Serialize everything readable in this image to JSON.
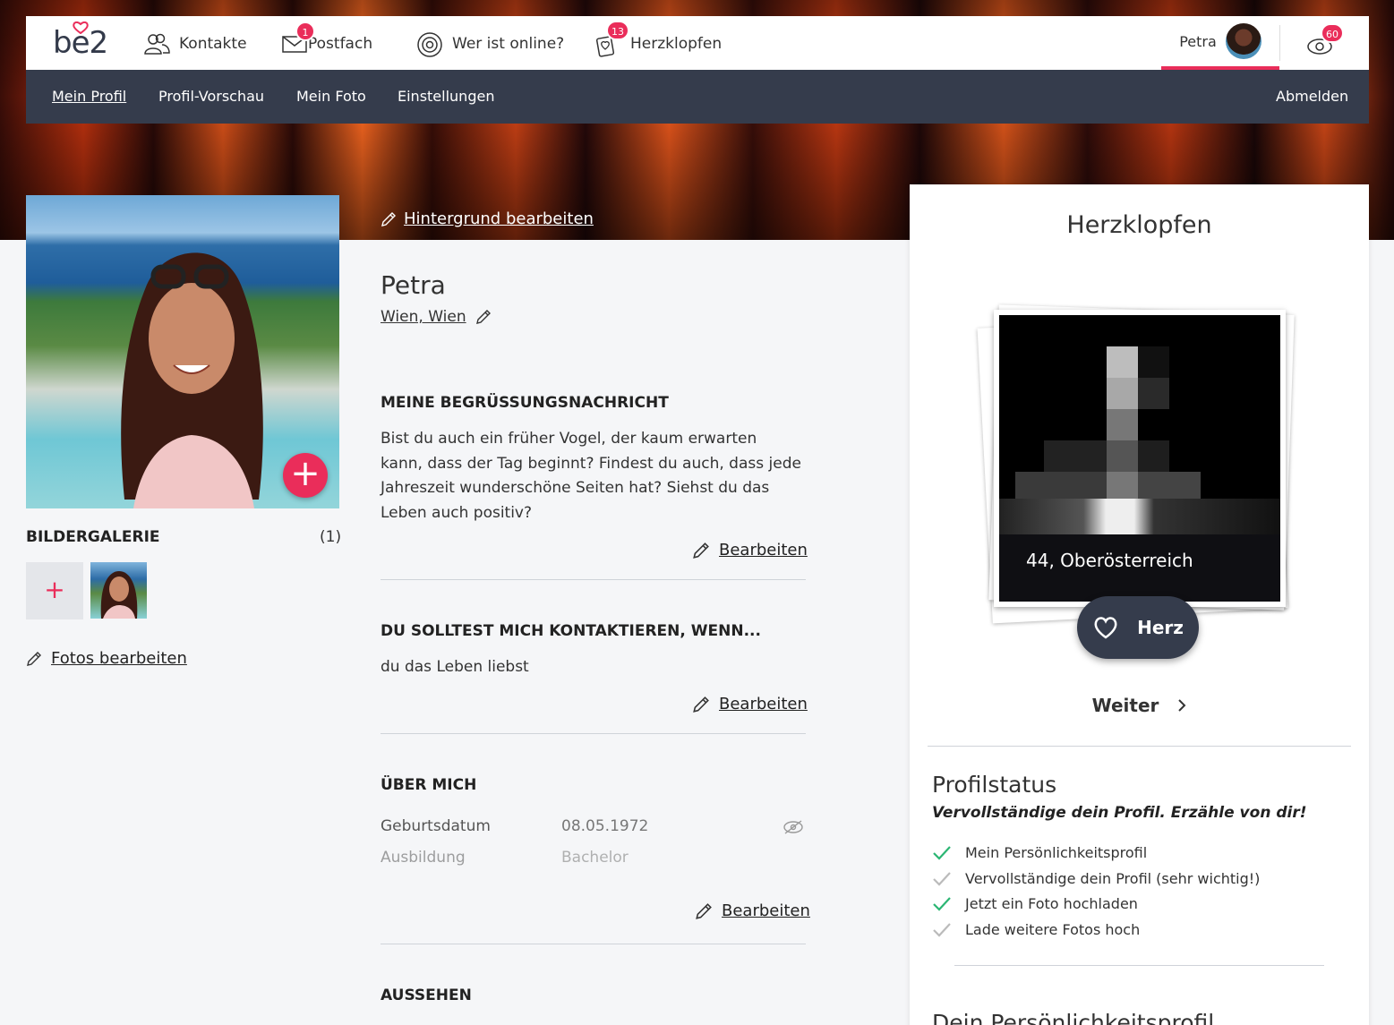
{
  "nav": {
    "logo": "be2",
    "items": [
      {
        "label": "Kontakte",
        "badge": ""
      },
      {
        "label": "Postfach",
        "badge": "1"
      },
      {
        "label": "Wer ist online?",
        "badge": ""
      },
      {
        "label": "Herzklopfen",
        "badge": "13"
      }
    ],
    "user_name": "Petra",
    "notifications_badge": "60"
  },
  "subnav": {
    "items": [
      "Mein Profil",
      "Profil-Vorschau",
      "Mein Foto",
      "Einstellungen"
    ],
    "logout": "Abmelden"
  },
  "left": {
    "gallery_title": "BILDERGALERIE",
    "gallery_count": "(1)",
    "edit_photos": "Fotos bearbeiten"
  },
  "main": {
    "bg_edit": "Hintergrund bearbeiten",
    "name": "Petra",
    "location": "Wien, Wien",
    "sections": [
      {
        "title": "MEINE BEGRÜSSUNGSNACHRICHT",
        "text": "Bist du auch ein früher Vogel, der kaum erwarten kann, dass der Tag beginnt? Findest du auch, dass jede Jahreszeit wunderschöne Seiten hat? Siehst du das Leben auch positiv?",
        "edit": "Bearbeiten"
      },
      {
        "title": "DU SOLLTEST MICH KONTAKTIEREN, WENN...",
        "text": "du das Leben liebst",
        "edit": "Bearbeiten"
      },
      {
        "title": "ÜBER MICH",
        "edit": "Bearbeiten",
        "rows": [
          {
            "key": "Geburtsdatum",
            "value": "08.05.1972"
          },
          {
            "key": "Ausbildung",
            "value": "Bachelor"
          }
        ]
      },
      {
        "title": "AUSSEHEN"
      }
    ]
  },
  "card": {
    "title": "Herzklopfen",
    "match_caption": "44, Oberösterreich",
    "heart_button": "Herz",
    "next": "Weiter",
    "status_title": "Profilstatus",
    "status_sub": "Vervollständige dein Profil. Erzähle von dir!",
    "status_items": [
      {
        "label": "Mein Persönlichkeitsprofil",
        "done": true
      },
      {
        "label": "Vervollständige dein Profil (sehr wichtig!)",
        "done": false
      },
      {
        "label": "Jetzt ein Foto hochladen",
        "done": true
      },
      {
        "label": "Lade weitere Fotos hoch",
        "done": false
      }
    ],
    "next_title": "Dein Persönlichkeitsprofil"
  },
  "colors": {
    "accent": "#ea2d5a",
    "navy": "#353c4c",
    "check": "#2bb673",
    "check_off": "#bbbbbb"
  }
}
